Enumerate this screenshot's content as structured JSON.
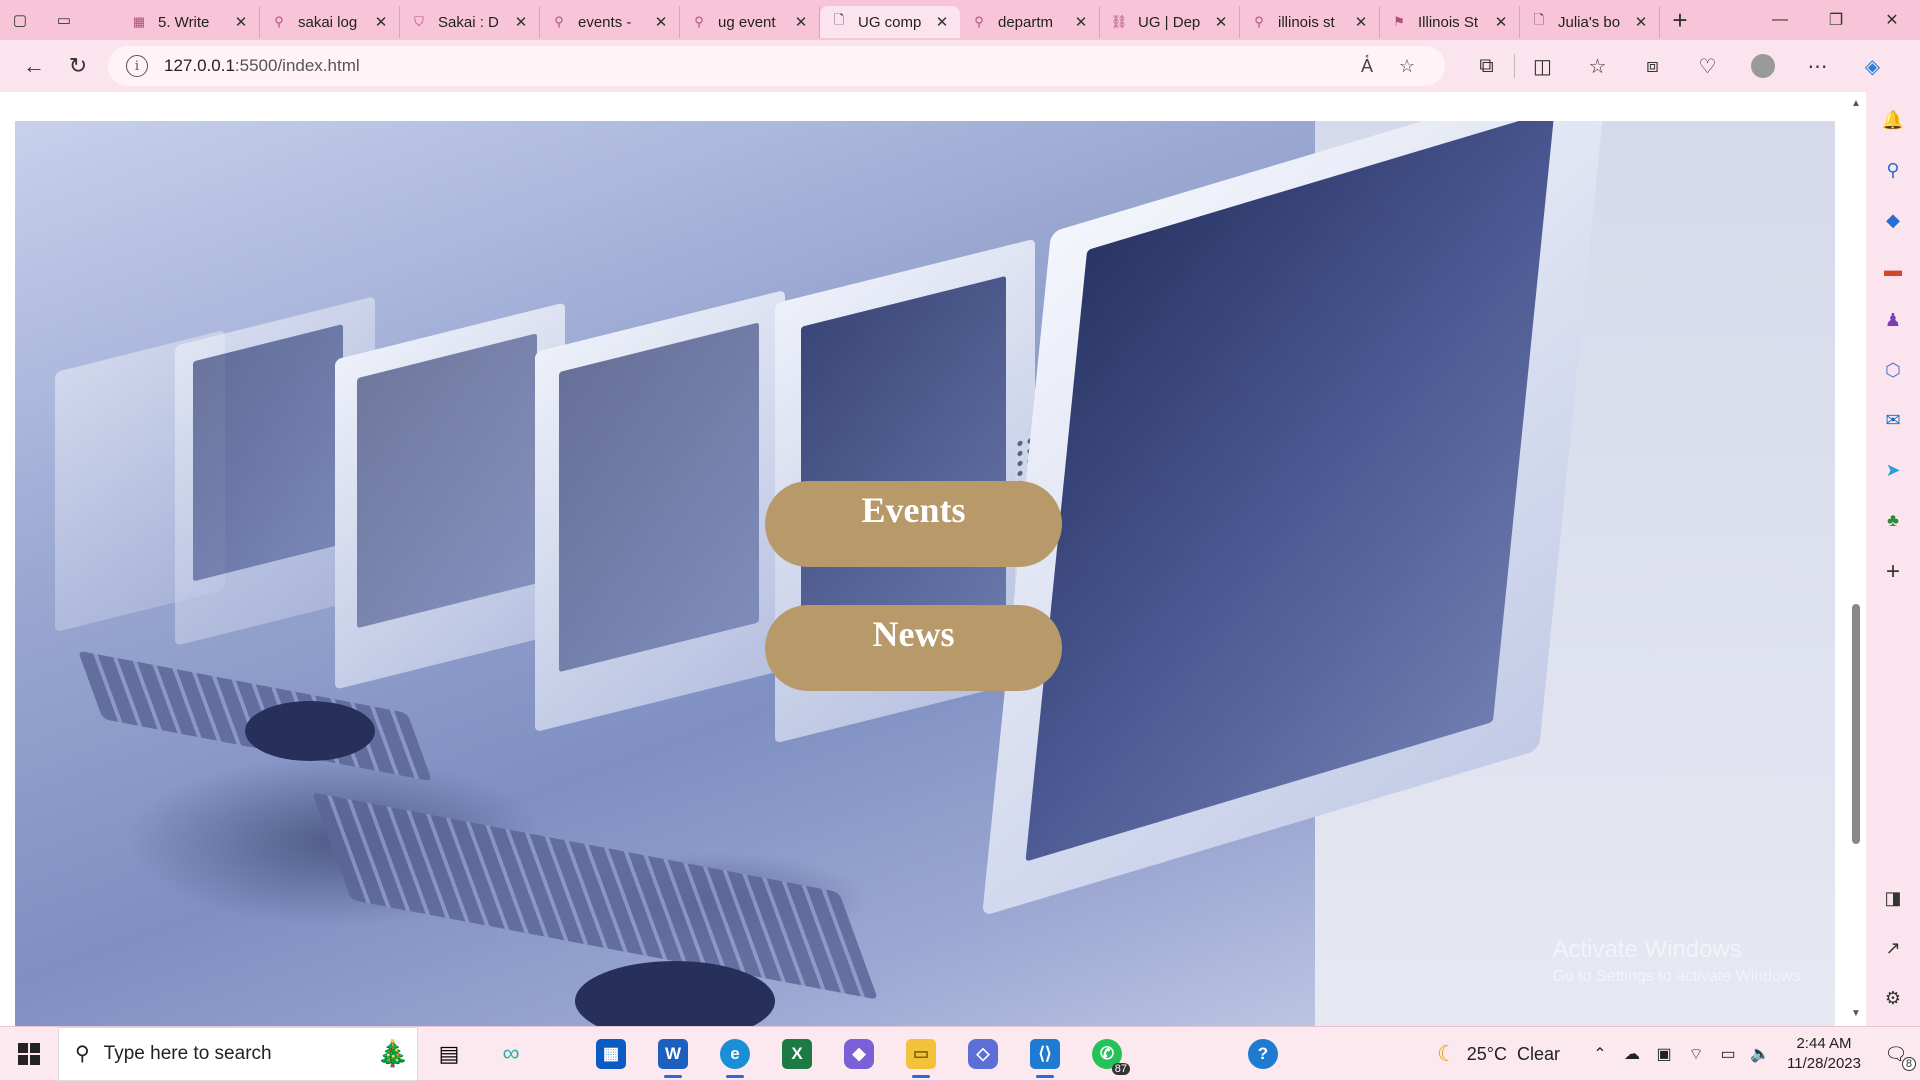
{
  "browser": {
    "tabs": [
      {
        "title": "5. Write",
        "icon": "grid-icon"
      },
      {
        "title": "sakai log",
        "icon": "search-icon"
      },
      {
        "title": "Sakai : D",
        "icon": "shield-icon"
      },
      {
        "title": "events -",
        "icon": "search-icon"
      },
      {
        "title": "ug event",
        "icon": "search-icon"
      },
      {
        "title": "UG comp",
        "icon": "page-icon",
        "active": true
      },
      {
        "title": "departm",
        "icon": "search-icon"
      },
      {
        "title": "UG | Dep",
        "icon": "link-icon"
      },
      {
        "title": "illinois st",
        "icon": "search-icon"
      },
      {
        "title": "Illinois St",
        "icon": "bookmark-icon"
      },
      {
        "title": "Julia's bo",
        "icon": "page-icon"
      }
    ],
    "url_host": "127.0.0.1",
    "url_rest": ":5500/index.html"
  },
  "page": {
    "buttons": {
      "events": "Events",
      "news": "News"
    },
    "watermark": {
      "title": "Activate Windows",
      "subtitle": "Go to Settings to activate Windows."
    }
  },
  "taskbar": {
    "search_placeholder": "Type here to search",
    "whatsapp_badge": "87",
    "weather": "25°C  Clear",
    "time": "2:44 AM",
    "date": "11/28/2023",
    "notification_count": "8"
  }
}
